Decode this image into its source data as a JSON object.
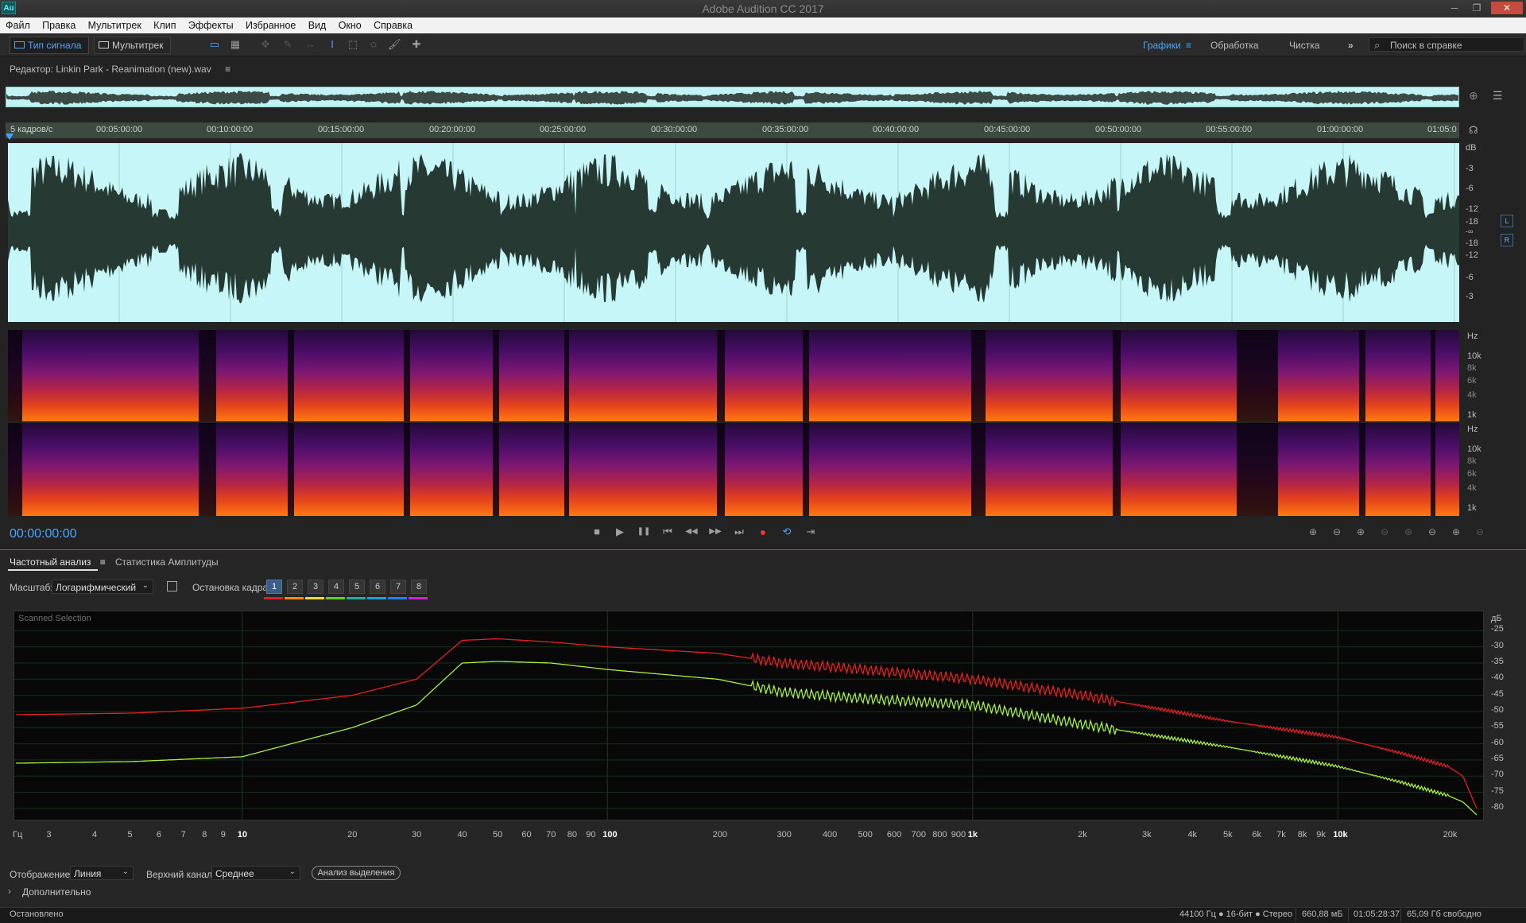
{
  "window": {
    "title": "Adobe Audition CC 2017",
    "app_icon": "Au",
    "minimize": "─",
    "restore": "❐",
    "close": "✕"
  },
  "menu": [
    "Файл",
    "Правка",
    "Мультитрек",
    "Клип",
    "Эффекты",
    "Избранное",
    "Вид",
    "Окно",
    "Справка"
  ],
  "toolbar": {
    "mode_waveform": "Тип сигнала",
    "mode_multitrack": "Мультитрек",
    "workspaces": {
      "graphics": "Графики",
      "menu_icon": "≡",
      "processing": "Обработка",
      "cleanup": "Чистка",
      "more": "»"
    },
    "search_placeholder": "Поиск в справке",
    "search_icon": "⌕"
  },
  "editor": {
    "label": "Редактор: Linkin Park - Reanimation (new).wav",
    "menu_icon": "≡",
    "ruler": {
      "fps": "5 кадров/с",
      "ticks": [
        "00:05:00:00",
        "00:10:00:00",
        "00:15:00:00",
        "00:20:00:00",
        "00:25:00:00",
        "00:30:00:00",
        "00:35:00:00",
        "00:40:00:00",
        "00:45:00:00",
        "00:50:00:00",
        "00:55:00:00",
        "01:00:00:00",
        "01:05:0"
      ]
    },
    "db_scale": [
      "dB",
      "-3",
      "-6",
      "-12",
      "-18",
      "-∞",
      "-18",
      "-12",
      "-6",
      "-3"
    ],
    "channels": {
      "left": "L",
      "right": "R"
    },
    "hz_scale": [
      "Hz",
      "10k",
      "8k",
      "6k",
      "4k",
      "1k"
    ]
  },
  "transport": {
    "timecode": "00:00:00:00",
    "buttons": {
      "stop": "■",
      "play": "▶",
      "pause": "❚❚",
      "to_start": "⏮",
      "rewind": "◀◀",
      "forward": "▶▶",
      "to_end": "⏭",
      "record": "●",
      "loop": "⟲",
      "skip": "⇥"
    }
  },
  "zoom_buttons": [
    "⊕",
    "⊖",
    "⊕",
    "⊖",
    "⊕",
    "⊖",
    "⊕",
    "⊖"
  ],
  "analysis": {
    "tab_frequency": "Частотный анализ",
    "tab_menu_icon": "≡",
    "tab_amplitude": "Статистика Амплитуды",
    "scale_label": "Масштаб:",
    "scale_value": "Логарифмический",
    "freeze_label": "Остановка кадра:",
    "frames": [
      "1",
      "2",
      "3",
      "4",
      "5",
      "6",
      "7",
      "8"
    ],
    "frame_colors": [
      "#e02020",
      "#ff8a00",
      "#f0e020",
      "#66d020",
      "#20b0a0",
      "#20a0e0",
      "#2080ff",
      "#d020d0"
    ],
    "plot_title": "Scanned Selection",
    "y_unit": "дБ",
    "y_ticks": [
      "-25",
      "-30",
      "-35",
      "-40",
      "-45",
      "-50",
      "-55",
      "-60",
      "-65",
      "-70",
      "-75",
      "-80"
    ],
    "x_unit": "Гц",
    "x_ticks": [
      "3",
      "4",
      "5",
      "6",
      "7",
      "8",
      "9",
      "10",
      "20",
      "30",
      "40",
      "50",
      "60",
      "70",
      "80",
      "90",
      "100",
      "200",
      "300",
      "400",
      "500",
      "600",
      "700",
      "800",
      "900",
      "1k",
      "2k",
      "3k",
      "4k",
      "5k",
      "6k",
      "7k",
      "8k",
      "9k",
      "10k",
      "20k"
    ],
    "display_label": "Отображение:",
    "display_value": "Линия",
    "channel_label": "Верхний канал:",
    "channel_value": "Среднее",
    "analyze_button": "Анализ выделения",
    "advanced": "Дополнительно",
    "advanced_chevron": "›"
  },
  "chart_data": {
    "type": "line",
    "xscale": "log",
    "xlim": [
      2.4,
      24000
    ],
    "ylim": [
      -82,
      -20
    ],
    "series": [
      {
        "color": "#e82020",
        "x": [
          2.4,
          5,
          10,
          20,
          30,
          40,
          50,
          70,
          100,
          200,
          300,
          500,
          1000,
          2000,
          5000,
          10000,
          15000,
          20000,
          22000,
          24000
        ],
        "y": [
          -51,
          -50.5,
          -49,
          -45,
          -40,
          -28,
          -27.5,
          -28.5,
          -30,
          -32,
          -35,
          -37,
          -40,
          -45,
          -53,
          -58,
          -63,
          -67,
          -70,
          -80
        ]
      },
      {
        "color": "#a8f040",
        "x": [
          2.4,
          5,
          10,
          20,
          30,
          40,
          50,
          70,
          100,
          200,
          300,
          500,
          1000,
          2000,
          5000,
          10000,
          15000,
          20000,
          22000,
          24000
        ],
        "y": [
          -66,
          -65.5,
          -64,
          -55,
          -48,
          -35,
          -34.5,
          -35,
          -37,
          -40,
          -44,
          -46,
          -48,
          -54,
          -61,
          -67,
          -72,
          -76,
          -78,
          -82
        ]
      }
    ]
  },
  "status": {
    "left": "Остановлено",
    "format": "44100 Гц ● 16-бит ● Стерео",
    "size": "660,88 мБ",
    "duration": "01:05:28:37",
    "free": "65,09 Гб свободно"
  }
}
